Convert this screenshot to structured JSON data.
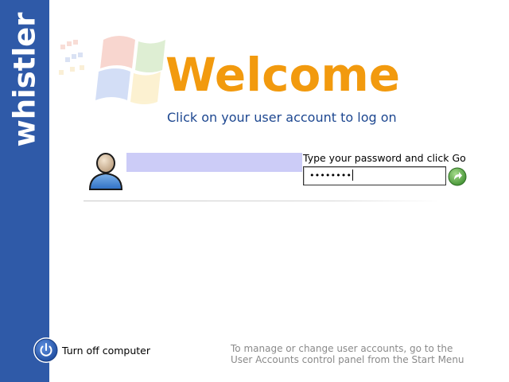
{
  "brand": {
    "text": "whistler",
    "band_color": "#2f5aa8"
  },
  "header": {
    "logo_icon": "windows-flag-icon",
    "title": "Welcome",
    "title_color": "#f29a0e",
    "subtitle": "Click on your user account to log on",
    "subtitle_color": "#1d4790"
  },
  "account": {
    "avatar_icon": "user-avatar-icon",
    "name": "",
    "highlight_color": "#ccccf7",
    "password_prompt": "Type your password and click Go",
    "password_value": "••••••••",
    "go_icon": "go-arrow-icon",
    "go_color": "#4d9a3c"
  },
  "footer": {
    "power_icon": "power-icon",
    "turn_off_label": "Turn off computer",
    "help_line1": "To manage or change user accounts, go to the",
    "help_line2": "User Accounts control panel from the Start Menu"
  }
}
